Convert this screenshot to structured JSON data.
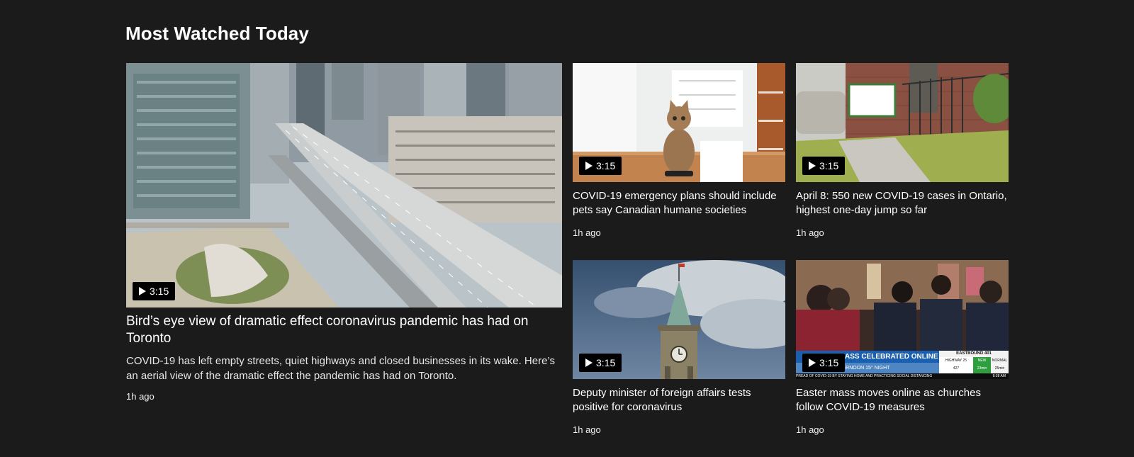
{
  "section": {
    "title": "Most Watched Today"
  },
  "featured": {
    "headline": "Bird’s eye view of dramatic effect coronavirus pandemic has had on Toronto",
    "description": "COVID-19 has left empty streets, quiet highways and closed businesses in its wake. Here’s an aerial view of the dramatic effect the pandemic has had on Toronto.",
    "time": "1h ago",
    "duration": "3:15",
    "thumbnail": "aerial-city-highway"
  },
  "videos": [
    {
      "headline": "COVID-19 emergency plans should include pets say Canadian humane societies",
      "time": "1h ago",
      "duration": "3:15",
      "thumbnail": "cat-in-kitchen"
    },
    {
      "headline": "April 8: 550 new COVID-19 cases in Ontario, highest one-day jump so far",
      "time": "1h ago",
      "duration": "3:15",
      "thumbnail": "covid-assessment-centre-sign"
    },
    {
      "headline": "Deputy minister of foreign affairs tests positive for coronavirus",
      "time": "1h ago",
      "duration": "3:15",
      "thumbnail": "peace-tower-sky"
    },
    {
      "headline": "Easter mass moves online as churches follow COVID-19 measures",
      "time": "1h ago",
      "duration": "3:15",
      "thumbnail": "church-congregation-broadcast",
      "ticker": {
        "banner": "ER MASS CELEBRATED ONLINE",
        "road": "EASTBOUND 401",
        "highway": "HIGHWAY 25",
        "highway_num": "427",
        "new_label": "NEW",
        "new_time": "23min",
        "normal_label": "NORMAL",
        "normal_time": "25min",
        "weather": "7° AFTERNOON 15° NIGHT",
        "crawl": "PREAD OF COVID-19 BY STAYING HOME AND PRACTICING SOCIAL DISTANCING",
        "clock": "8:38 AM"
      }
    }
  ]
}
